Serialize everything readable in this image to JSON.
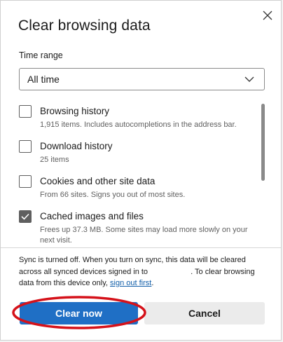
{
  "dialog": {
    "title": "Clear browsing data",
    "time_range": {
      "label": "Time range",
      "selected": "All time"
    },
    "items": [
      {
        "title": "Browsing history",
        "desc": "1,915 items. Includes autocompletions in the address bar.",
        "checked": false
      },
      {
        "title": "Download history",
        "desc": "25 items",
        "checked": false
      },
      {
        "title": "Cookies and other site data",
        "desc": "From 66 sites. Signs you out of most sites.",
        "checked": false
      },
      {
        "title": "Cached images and files",
        "desc": "Frees up 37.3 MB. Some sites may load more slowly on your next visit.",
        "checked": true
      }
    ],
    "sync": {
      "text_before": "Sync is turned off. When you turn on sync, this data will be cleared across all synced devices signed in to",
      "text_middle": ". To clear browsing data from this device only,",
      "link": "sign out first",
      "text_after": "."
    },
    "buttons": {
      "clear": "Clear now",
      "cancel": "Cancel"
    }
  },
  "colors": {
    "primary": "#1f6fc5",
    "highlight_ring": "#d5121a",
    "link": "#0f5da8"
  }
}
